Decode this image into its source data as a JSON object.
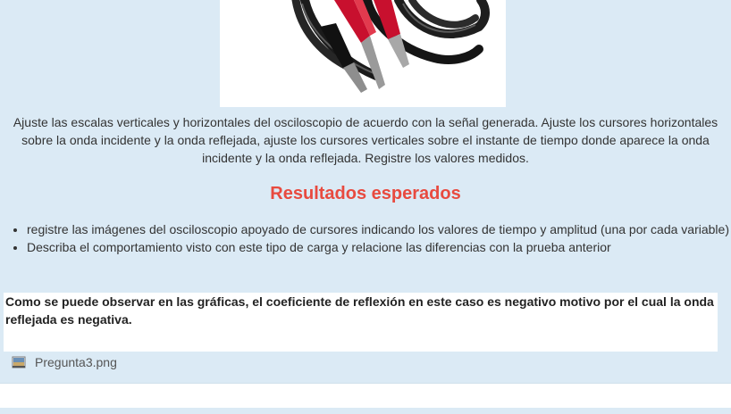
{
  "image": {
    "alt": "cable con pinzas de cocodrilo"
  },
  "content": {
    "intro": "Ajuste las escalas verticales y horizontales del osciloscopio de acuerdo con la señal generada. Ajuste los cursores horizontales sobre la onda incidente y la onda reflejada, ajuste los cursores verticales sobre el instante de tiempo donde aparece la onda incidente y la onda reflejada. Registre los valores medidos.",
    "heading": "Resultados esperados",
    "bullets": [
      "registre las imágenes del osciloscopio apoyado de cursores indicando los valores de tiempo y amplitud (una por cada variable)",
      "Describa el comportamiento visto con este tipo de carga y relacione las diferencias con la prueba anterior"
    ]
  },
  "answer": {
    "text": "Como se puede observar en las gráficas, el coeficiente de reflexión en este caso es negativo motivo por el cual la onda reflejada es negativa."
  },
  "attachment": {
    "icon": "image-file-icon",
    "filename": "Pregunta3.png"
  },
  "colors": {
    "background": "#dbeaf5",
    "heading": "#e84a3f",
    "answer_bg": "#ffffff"
  }
}
